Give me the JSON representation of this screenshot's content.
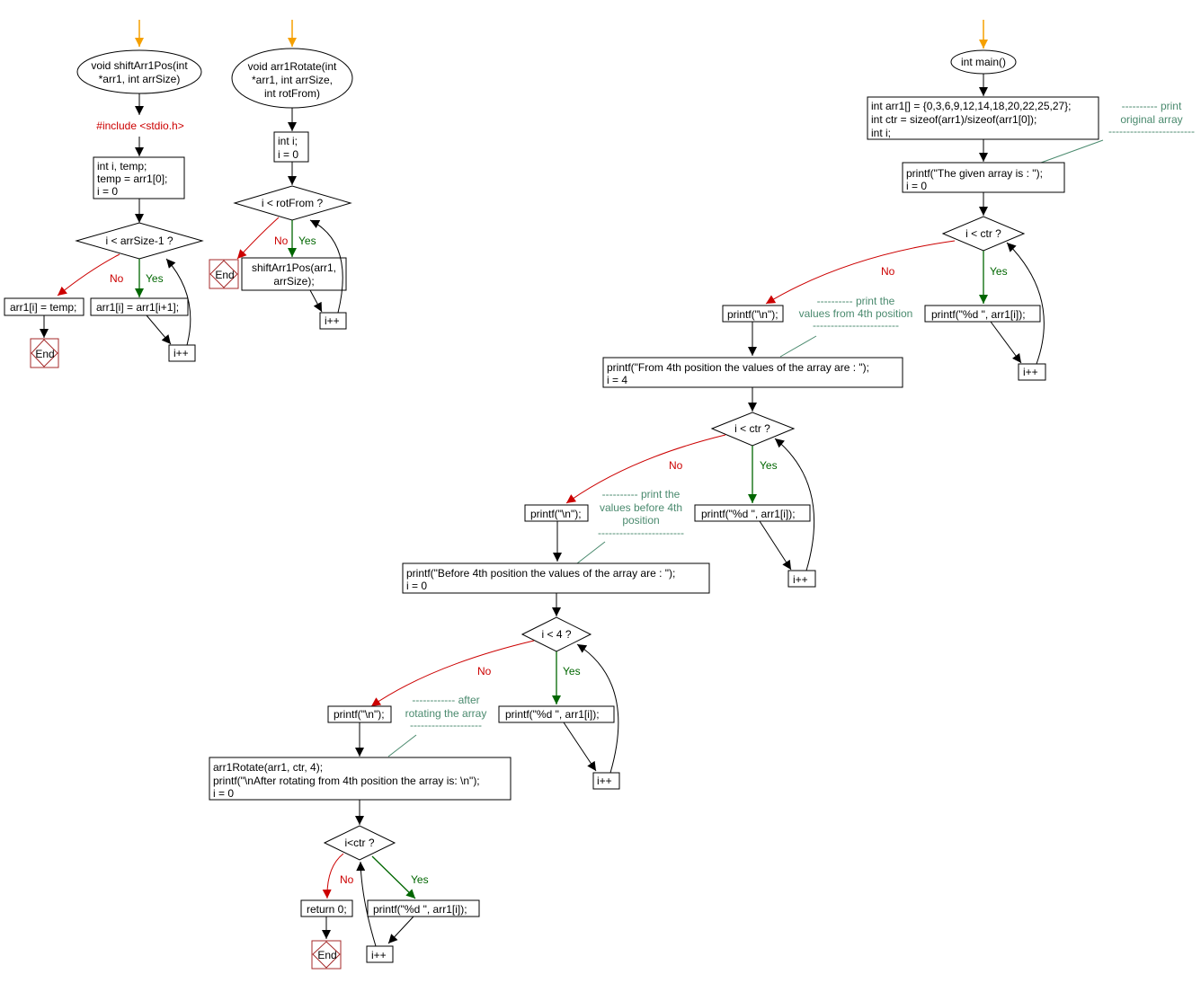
{
  "colors": {
    "start_arrow": "#f5a000",
    "flow": "#000000",
    "no_branch": "#cc0000",
    "yes_branch": "#006600",
    "comment": "#4a8a6e",
    "end_border": "#a52a2a"
  },
  "labels": {
    "yes": "Yes",
    "no": "No",
    "end": "End",
    "increment": "i++"
  },
  "shiftArr1Pos": {
    "start": [
      "void shiftArr1Pos(int",
      "*arr1, int arrSize)"
    ],
    "include": "#include <stdio.h>",
    "init": [
      "int i, temp;",
      "temp = arr1[0];",
      "i = 0"
    ],
    "condition": "i < arrSize-1 ?",
    "no_action": "arr1[i] = temp;",
    "yes_action": "arr1[i] = arr1[i+1];",
    "increment": "i++",
    "end": "End"
  },
  "arr1Rotate": {
    "start": [
      "void arr1Rotate(int",
      "*arr1, int arrSize,",
      "int rotFrom)"
    ],
    "init": [
      "int i;",
      "i = 0"
    ],
    "condition": "i < rotFrom ?",
    "yes_action": [
      "shiftArr1Pos(arr1,",
      "arrSize);"
    ],
    "increment": "i++",
    "end": "End"
  },
  "main": {
    "start": "int main()",
    "declarations": [
      "int arr1[] = {0,3,6,9,12,14,18,20,22,25,27};",
      "int ctr = sizeof(arr1)/sizeof(arr1[0]);",
      "int i;"
    ],
    "comment1": [
      "---------- print",
      "original array",
      "------------------------"
    ],
    "print_given": [
      "printf(\"The given array is :  \");",
      "i = 0"
    ],
    "cond1": "i < ctr ?",
    "loop1_yes": "printf(\"%d  \", arr1[i]);",
    "loop1_no": "printf(\"\\n\");",
    "comment2": [
      "---------- print the",
      "values from 4th position",
      "------------------------"
    ],
    "print_from": [
      "printf(\"From 4th position the values of the array are :  \");",
      "i = 4"
    ],
    "cond2": "i < ctr ?",
    "loop2_yes": "printf(\"%d  \", arr1[i]);",
    "loop2_no": "printf(\"\\n\");",
    "comment3": [
      "---------- print the",
      "values before 4th",
      "position",
      "------------------------"
    ],
    "print_before": [
      "printf(\"Before 4th position the values of the array are :  \");",
      "i = 0"
    ],
    "cond3": "i < 4 ?",
    "loop3_yes": "printf(\"%d  \", arr1[i]);",
    "loop3_no": "printf(\"\\n\");",
    "comment4": [
      "------------ after",
      "rotating the array",
      "--------------------"
    ],
    "rotate_block": [
      "arr1Rotate(arr1, ctr, 4);",
      "printf(\"\\nAfter rotating from 4th position the array is: \\n\");",
      "i = 0"
    ],
    "cond4": "i<ctr ?",
    "loop4_yes": "printf(\"%d \", arr1[i]);",
    "return": "return 0;",
    "end": "End"
  }
}
